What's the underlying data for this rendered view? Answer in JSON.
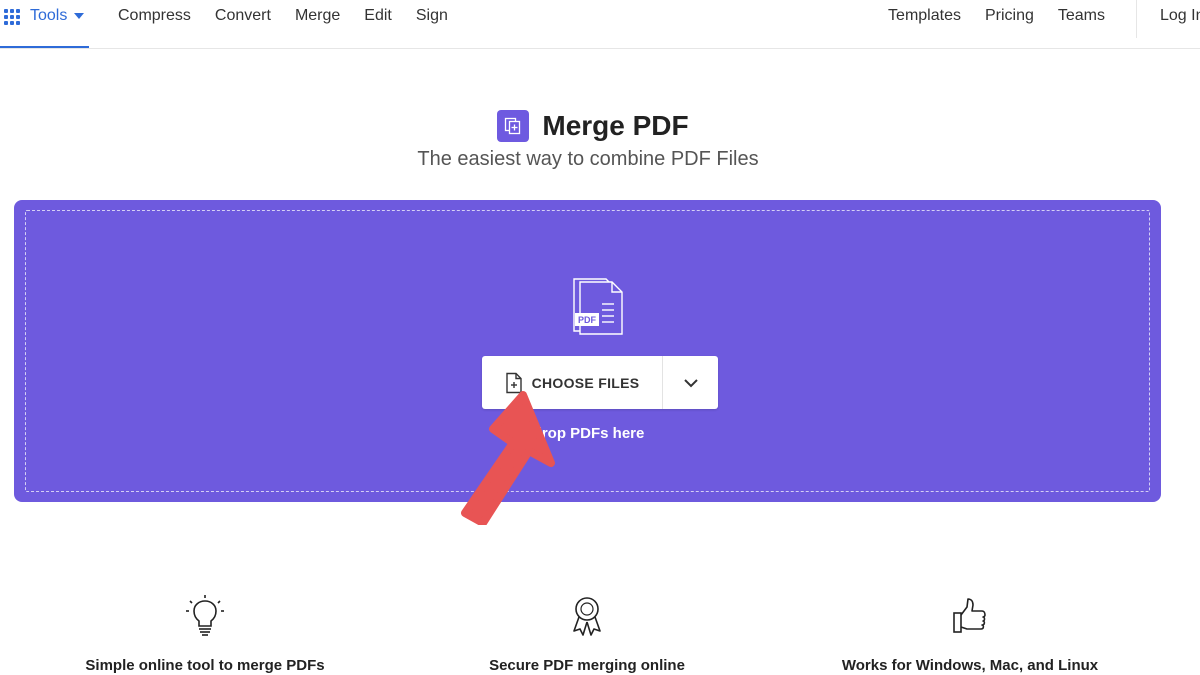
{
  "nav": {
    "tools_label": "Tools",
    "links": [
      "Compress",
      "Convert",
      "Merge",
      "Edit",
      "Sign"
    ],
    "right_links": [
      "Templates",
      "Pricing",
      "Teams"
    ],
    "login": "Log In",
    "accent": "#2e6bd8"
  },
  "header": {
    "title": "Merge PDF",
    "subtitle": "The easiest way to combine PDF Files",
    "icon": "merge-pdf-icon"
  },
  "dropzone": {
    "background": "#6e5ade",
    "choose_label": "CHOOSE FILES",
    "drop_hint": "drop PDFs here",
    "icon": "pdf-files-icon"
  },
  "annotation": {
    "arrow_color": "#e85454"
  },
  "features": [
    {
      "icon": "lightbulb-icon",
      "label": "Simple online tool to merge PDFs"
    },
    {
      "icon": "award-ribbon-icon",
      "label": "Secure PDF merging online"
    },
    {
      "icon": "thumbs-up-icon",
      "label": "Works for Windows, Mac, and Linux"
    }
  ]
}
